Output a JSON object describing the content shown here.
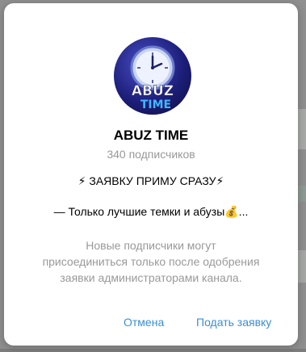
{
  "channel": {
    "title": "ABUZ TIME",
    "subscribers": "340 подписчиков",
    "description_line1": "⚡ ЗАЯВКУ ПРИМУ СРАЗУ⚡",
    "description_line2": "— Только лучшие темки и абузы💰...",
    "avatar_text_top": "ABUZ",
    "avatar_text_bottom": "TIME"
  },
  "notice": {
    "line1": "Новые подписчики могут",
    "line2": "присоединиться только после одобрения",
    "line3": "заявки администраторами канала."
  },
  "buttons": {
    "cancel": "Отмена",
    "request": "Подать заявку"
  },
  "colors": {
    "accent": "#3a8fd4",
    "muted_text": "#999999",
    "avatar_bg": "#1d1f7a"
  }
}
